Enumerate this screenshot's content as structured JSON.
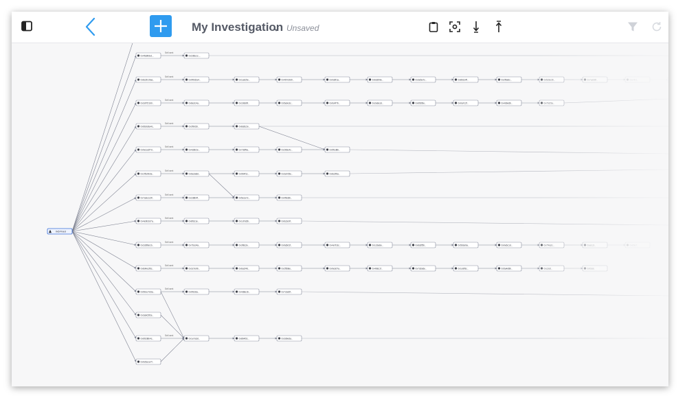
{
  "toolbar": {
    "title": "My Investigation",
    "status": "Unsaved"
  },
  "colors": {
    "accent": "#2f9bef",
    "node_border": "#8a8fa0",
    "edge": "#7d8190",
    "root_border": "#3a6fd8"
  },
  "icons": {
    "sidebar": "sidebar-toggle-icon",
    "back": "chevron-left-icon",
    "add": "plus-icon",
    "caret": "chevron-down-icon",
    "clipboard": "clipboard-icon",
    "focus": "focus-frame-icon",
    "collapse_down": "arrow-down-icon",
    "expand_up": "arrow-up-icon",
    "filter": "filter-icon",
    "refresh": "refresh-icon"
  },
  "graph": {
    "root_label": "0x6 Fixed",
    "edge_label": "Sell sent",
    "rows": [
      {
        "labels": [
          "0x1a4c9f0c3b..",
          "0xa7c1e5d2.."
        ],
        "edge_labels": [
          "Sell sent"
        ]
      },
      {
        "labels": [
          "0x4fa9b6e1..",
          "0x2d6e1c..."
        ],
        "edge_labels": [
          "Sell sent"
        ]
      },
      {
        "labels": [
          "0x8c2b19ae..",
          "0x9f0d2a4..",
          "0x1a3c5e..",
          "0x4b7e9d0..",
          "0x0c8f1a..",
          "0x6d2b9e..",
          "0x3e5a7c..",
          "0x8b1d4f..",
          "0x2f6a0c..",
          "0x5c9e3b..",
          "0x7a2d6f..",
          "0xe4b1..",
          "0xd9a3.."
        ],
        "edge_labels": [
          "Sell sent"
        ]
      },
      {
        "labels": [
          "0x3d7f21b0..",
          "0x8e2c4a..",
          "0x1b6d9f..",
          "0x5a0e3c..",
          "0x9c4f7b..",
          "0x2e8a1d..",
          "0x6f3b5e..",
          "0x0a7c2f..",
          "0x4d9e6b..",
          "0x7b1f3a.."
        ],
        "edge_labels": [
          "Sell sent"
        ]
      },
      {
        "labels": [
          "0x6b2e8a4c..",
          "0x3f9d1b..",
          "0x8a5c2e.."
        ],
        "edge_labels": [
          "Sell sent"
        ]
      },
      {
        "labels": [
          "0x9e1a3f7d..",
          "0x4c8b2e..",
          "0x7d3f9a..",
          "0x2b6e4c..",
          "0x5f1d8b.."
        ],
        "edge_labels": [
          "Sell sent"
        ]
      },
      {
        "labels": [
          "0x1f5c9b3e..",
          "0x6e2a8d..",
          "0x9b4f1c..",
          "0x3a7d5e..",
          "0x8c2f6a.."
        ],
        "edge_labels": [
          "Sell sent"
        ]
      },
      {
        "labels": [
          "0x7a3e1c9f..",
          "0x2d8b4f..",
          "0x5e1a7c..",
          "0x0f6d3b.."
        ],
        "edge_labels": [
          "Sell sent"
        ]
      },
      {
        "labels": [
          "0x4e9b2d7a..",
          "0x8f3c1e..",
          "0x1d7a5b..",
          "0x6c2e9f.."
        ],
        "edge_labels": [
          "Sell sent"
        ]
      },
      {
        "labels": [
          "0x2c6f8e1b..",
          "0x7b1d4a..",
          "0x3f8c2e..",
          "0x9a5d1f..",
          "0x4e7b3c..",
          "0x1c9a6e..",
          "0x8d2f5b..",
          "0x5b3e9a..",
          "0x0e6c1d..",
          "0x7f4a2c..",
          "0xa1c3..",
          "0xb5e7.."
        ],
        "edge_labels": [
          "Sell sent"
        ]
      },
      {
        "labels": [
          "0x8d4a1f6c..",
          "0x3c7e9b..",
          "0x6a1f4d..",
          "0x2f5b8e..",
          "0x9e3d7a..",
          "0x4b8c1f..",
          "0x7d2a6e..",
          "0x1e9f3c..",
          "0x5a4d8b..",
          "0xc2e6..",
          "0xf3a9.."
        ],
        "edge_labels": [
          "Sell sent"
        ]
      },
      {
        "labels": [
          "0x5b1e7d3a..",
          "0x9f2c6a..",
          "0x4d8e1b..",
          "0x7c3a5f.."
        ],
        "edge_labels": [
          "Sell sent",
          "Sell sent"
        ]
      },
      {
        "labels": [
          "0x3a9c5f2e.."
        ],
        "edge_labels": []
      },
      {
        "labels": [
          "0x6f2d8b4c..",
          "0x1e7a3d..",
          "0x8b4f2c..",
          "0x3d9e6a.."
        ],
        "edge_labels": [
          "Sell sent"
        ]
      },
      {
        "labels": [
          "0x9c5a1e7f.."
        ],
        "edge_labels": []
      }
    ]
  }
}
